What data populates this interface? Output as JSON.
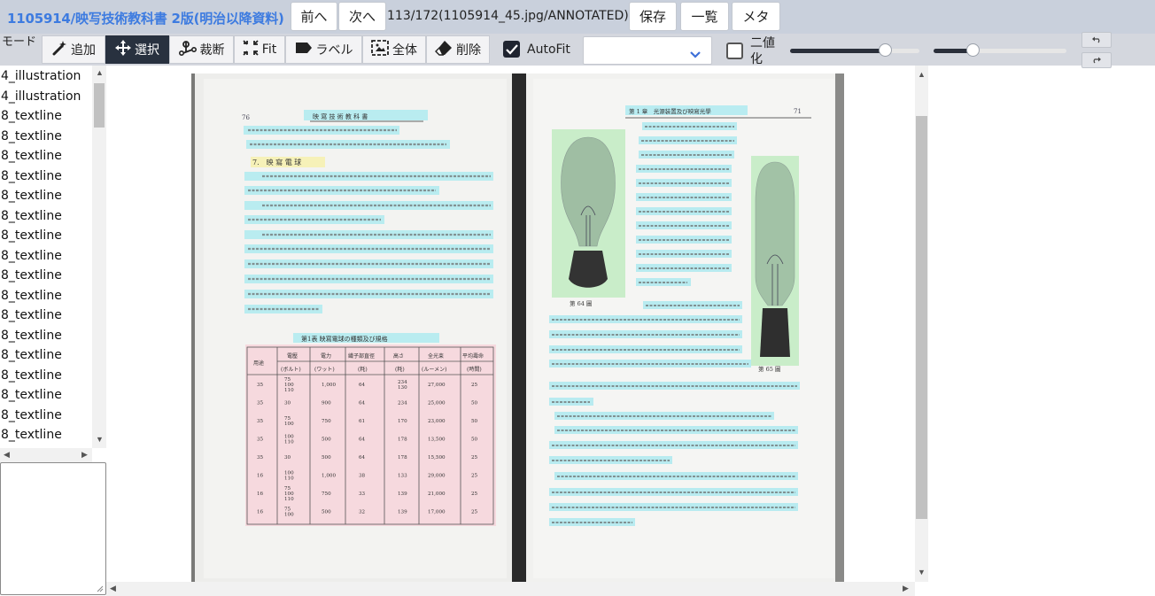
{
  "header": {
    "title": "1105914/映写技術教科書 2版(明治以降資料)",
    "prev_label": "前へ",
    "next_label": "次へ",
    "page_info": "113/172(1105914_45.jpg/ANNOTATED)",
    "save_label": "保存",
    "list_label": "一覧",
    "meta_label": "メタ"
  },
  "toolbar": {
    "mode_label": "モード",
    "tools": [
      {
        "label": "追加",
        "icon": "magic-wand-icon"
      },
      {
        "label": "選択",
        "icon": "move-arrows-icon",
        "active": true
      },
      {
        "label": "裁断",
        "icon": "split-icon"
      },
      {
        "label": "Fit",
        "icon": "fit-icon"
      },
      {
        "label": "ラベル",
        "icon": "label-tag-icon"
      },
      {
        "label": "全体",
        "icon": "select-all-icon"
      },
      {
        "label": "削除",
        "icon": "eraser-icon"
      }
    ],
    "autofit_label": "AutoFit",
    "autofit_checked": true,
    "select_value": "",
    "binarize_label": "二値化",
    "binarize_checked": false,
    "slider1_value": 0.73,
    "slider2_value": 0.29,
    "undo_icon": "undo-icon",
    "redo_icon": "redo-icon"
  },
  "layers": [
    "4_illustration",
    "4_illustration",
    "8_textline",
    "8_textline",
    "8_textline",
    "8_textline",
    "8_textline",
    "8_textline",
    "8_textline",
    "8_textline",
    "8_textline",
    "8_textline",
    "8_textline",
    "8_textline",
    "8_textline",
    "8_textline",
    "8_textline",
    "8_textline",
    "8_textline"
  ],
  "book_page": {
    "left_page_number": "76",
    "left_running_head": "映 寫 技 術 教 科 書",
    "right_running_head": "第 1 章　光源装置及び映寫光學",
    "right_page_number": "71",
    "section_heading": "7.　映 寫 電 球",
    "table_title": "第1表 映寫電球の種類及び規格",
    "fig64_caption": "第 64 圖",
    "fig65_caption": "第 65 圖",
    "table_headers": [
      "用途",
      "電壓",
      "電力",
      "繊子部直徑",
      "高さ",
      "全光束",
      "平均壽命"
    ],
    "table_units": [
      "",
      "(ボルト)",
      "(ワット)",
      "(粍)",
      "(粍)",
      "(ルーメン)",
      "(時間)"
    ],
    "table_rows": [
      [
        "35",
        "75\n100\n110",
        "1,000",
        "64",
        "234\n130",
        "27,000",
        "25"
      ],
      [
        "35",
        "30",
        "900",
        "64",
        "234",
        "25,000",
        "50"
      ],
      [
        "35",
        "75\n100",
        "750",
        "61",
        "170",
        "23,000",
        "50"
      ],
      [
        "35",
        "100\n110",
        "500",
        "64",
        "178",
        "13,500",
        "50"
      ],
      [
        "35",
        "30",
        "500",
        "64",
        "178",
        "15,500",
        "25"
      ],
      [
        "16",
        "100\n110",
        "1,000",
        "38",
        "133",
        "29,000",
        "25"
      ],
      [
        "16",
        "75\n100\n110",
        "750",
        "33",
        "139",
        "21,000",
        "25"
      ],
      [
        "16",
        "75\n100",
        "500",
        "32",
        "139",
        "17,000",
        "25"
      ]
    ]
  },
  "colors": {
    "accent": "#3d7be0",
    "header_bg": "#c9d0dc",
    "toolbar_bg": "#d4d7de",
    "active_tool_bg": "#28313f",
    "textline_highlight": "#aeeaf0",
    "illustration_highlight": "#c4ecc4",
    "table_highlight": "#f6d6dc",
    "heading_highlight": "#f6f0b4"
  }
}
